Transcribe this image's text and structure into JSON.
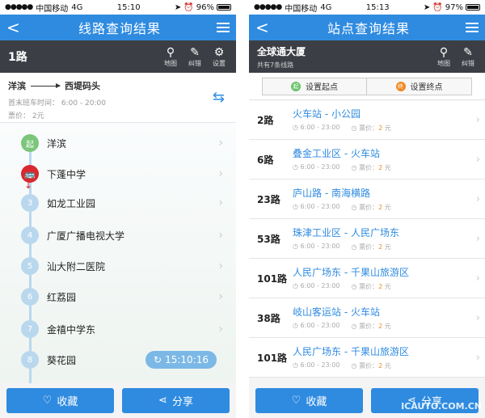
{
  "left": {
    "status": {
      "carrier": "中国移动",
      "network": "4G",
      "time": "15:10",
      "battery": "96%"
    },
    "nav": {
      "back": "<",
      "title": "线路查询结果"
    },
    "route": {
      "name": "1路",
      "map": "地图",
      "report": "纠错",
      "settings": "设置"
    },
    "info": {
      "from": "洋滨",
      "to": "西堤码头",
      "times": "首末班车时间：  6:00 - 20:00",
      "price": "票价：  2元"
    },
    "stops": [
      {
        "badge": "起",
        "name": "洋滨"
      },
      {
        "badge": "",
        "name": "下蓬中学"
      },
      {
        "badge": "3",
        "name": "如龙工业园"
      },
      {
        "badge": "4",
        "name": "广厦广播电视大学"
      },
      {
        "badge": "5",
        "name": "汕大附二医院"
      },
      {
        "badge": "6",
        "name": "红荔园"
      },
      {
        "badge": "7",
        "name": "金禧中学东"
      },
      {
        "badge": "8",
        "name": "葵花园"
      }
    ],
    "time_pill": "15:10:16",
    "buttons": {
      "favorite": "收藏",
      "share": "分享"
    }
  },
  "right": {
    "status": {
      "carrier": "中国移动",
      "network": "4G",
      "time": "15:13",
      "battery": "97%"
    },
    "nav": {
      "back": "<",
      "title": "站点查询结果"
    },
    "station": {
      "name": "全球通大厦",
      "count": "共有7条线路",
      "map": "地图",
      "report": "纠错"
    },
    "set_start": "设置起点",
    "set_end": "设置终点",
    "rows": [
      {
        "route": "2路",
        "dest": "火车站 - 小公园",
        "time": "6:00 - 23:00",
        "price_label": "票价：",
        "price": "2",
        "unit": "元"
      },
      {
        "route": "6路",
        "dest": "叠金工业区 - 火车站",
        "time": "6:00 - 23:00",
        "price_label": "票价：",
        "price": "2",
        "unit": "元"
      },
      {
        "route": "23路",
        "dest": "庐山路 - 南海横路",
        "time": "6:00 - 23:00",
        "price_label": "票价：",
        "price": "2",
        "unit": "元"
      },
      {
        "route": "53路",
        "dest": "珠津工业区 - 人民广场东",
        "time": "6:00 - 23:00",
        "price_label": "票价：",
        "price": "2",
        "unit": "元"
      },
      {
        "route": "101路",
        "dest": "人民广场东 - 千果山旅游区",
        "time": "6:00 - 23:00",
        "price_label": "票价：",
        "price": "2",
        "unit": "元"
      },
      {
        "route": "38路",
        "dest": "岐山客运站 - 火车站",
        "time": "6:00 - 23:00",
        "price_label": "票价：",
        "price": "2",
        "unit": "元"
      },
      {
        "route": "101路",
        "dest": "人民广场东 - 千果山旅游区",
        "time": "6:00 - 23:00",
        "price_label": "票价：",
        "price": "2",
        "unit": "元"
      }
    ],
    "buttons": {
      "favorite": "收藏",
      "share": "分享"
    },
    "watermark": "ICAUTO.COM.CN"
  }
}
